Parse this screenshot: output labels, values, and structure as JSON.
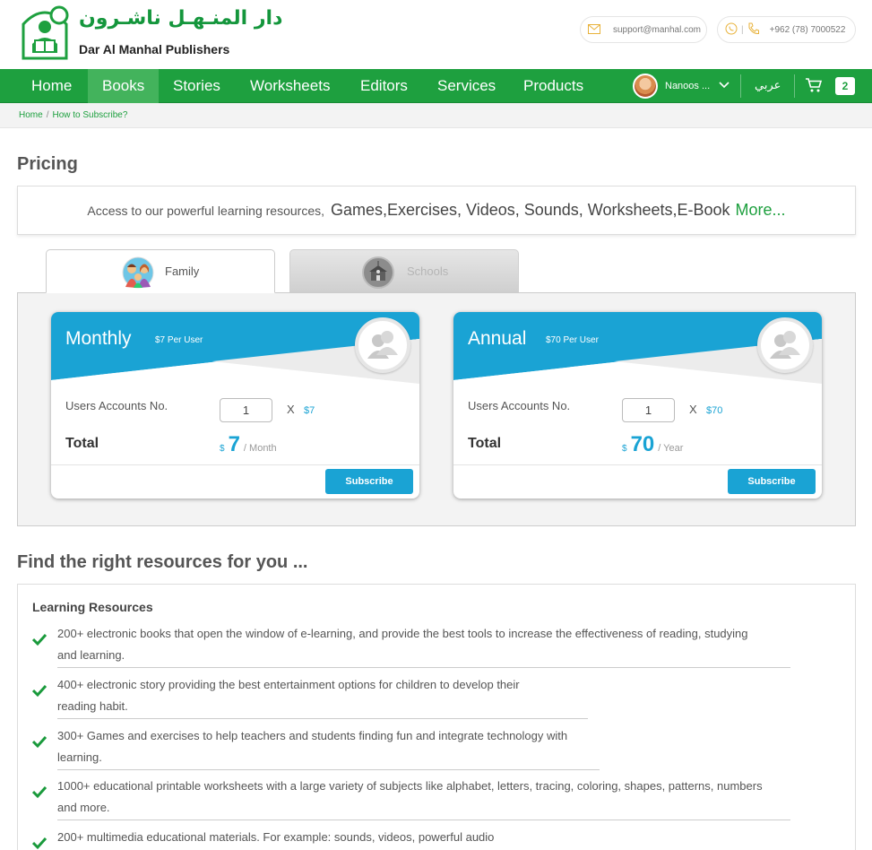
{
  "header": {
    "logo_arabic": "دار المنـهـل ناشـرون",
    "logo_english": "Dar Al Manhal Publishers",
    "email": "support@manhal.com",
    "phone": "+962 (78) 7000522",
    "phone_sep": "|"
  },
  "nav": {
    "items": [
      "Home",
      "Books",
      "Stories",
      "Worksheets",
      "Editors",
      "Services",
      "Products"
    ],
    "active": "Books",
    "user_name": "Nanoos ...",
    "language": "عربي",
    "cart_count": "2"
  },
  "breadcrumb": {
    "home": "Home",
    "separator": "/",
    "current": "How to Subscribe?"
  },
  "pricing": {
    "title": "Pricing",
    "access_lead": "Access to our powerful learning resources,",
    "access_features": "Games,Exercises, Videos, Sounds, Worksheets,E-Book",
    "access_more": "More..."
  },
  "tabs": {
    "family": "Family",
    "schools": "Schools"
  },
  "plans": {
    "monthly": {
      "name": "Monthly",
      "per_user": "$7 Per User",
      "accounts_label": "Users Accounts No.",
      "quantity": "1",
      "times": "X",
      "unit_price": "$7",
      "total_label": "Total",
      "currency": "$",
      "total": "7",
      "period": "/ Month",
      "button": "Subscribe"
    },
    "annual": {
      "name": "Annual",
      "per_user": "$70 Per User",
      "accounts_label": "Users Accounts No.",
      "quantity": "1",
      "times": "X",
      "unit_price": "$70",
      "total_label": "Total",
      "currency": "$",
      "total": "70",
      "period": "/ Year",
      "button": "Subscribe"
    }
  },
  "resources": {
    "title": "Find the right resources for you ...",
    "section": "Learning Resources",
    "items": [
      [
        "200+ electronic books that open the window of e-learning, and provide the best tools to increase the effectiveness of reading, studying",
        "and learning."
      ],
      [
        "400+ electronic story providing the best entertainment options for children to develop their",
        "reading habit."
      ],
      [
        "300+ Games and exercises to help teachers and students finding fun and integrate technology with",
        "learning."
      ],
      [
        "1000+ educational printable worksheets with a large variety of subjects like alphabet, letters, tracing, coloring, shapes, patterns, numbers",
        "and more."
      ],
      [
        "200+ multimedia educational materials. For example: sounds, videos, powerful audio",
        ""
      ]
    ]
  },
  "colors": {
    "brand_green": "#1ea03f",
    "nav_active": "#43b35c",
    "plan_blue": "#1aa3d4",
    "check_green": "#1a9a3c"
  }
}
